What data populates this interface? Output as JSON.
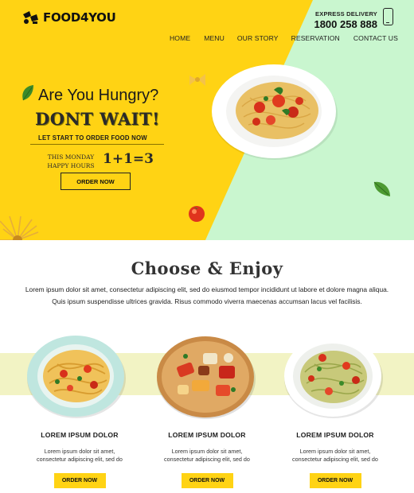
{
  "brand": {
    "name": "FOOD4YOU"
  },
  "contact": {
    "label": "EXPRESS DELIVERY",
    "phone": "1800 258 888"
  },
  "nav": [
    {
      "label": "HOME"
    },
    {
      "label": "MENU"
    },
    {
      "label": "OUR STORY"
    },
    {
      "label": "RESERVATION"
    },
    {
      "label": "CONTACT US"
    }
  ],
  "hero": {
    "title": "Are You Hungry?",
    "subtitle": "DONT WAIT!",
    "tagline": "LET START TO ORDER FOOD NOW",
    "happy_hours_label": "THIS MONDAY HAPPY HOURS",
    "happy_hours_value": "1+1=3",
    "cta": "ORDER NOW"
  },
  "section": {
    "title": "Choose & Enjoy",
    "text": "Lorem ipsum dolor sit amet, consectetur adipiscing elit, sed do eiusmod tempor incididunt ut labore et dolore magna aliqua. Quis ipsum suspendisse ultrices gravida. Risus commodo viverra maecenas accumsan lacus vel facilisis."
  },
  "cards": [
    {
      "title": "LOREM IPSUM DOLOR",
      "text": "Lorem ipsum dolor sit amet, consectetur adipiscing elit, sed do",
      "cta": "ORDER NOW"
    },
    {
      "title": "LOREM IPSUM DOLOR",
      "text": "Lorem ipsum dolor sit amet, consectetur adipiscing elit, sed do",
      "cta": "ORDER NOW"
    },
    {
      "title": "LOREM IPSUM DOLOR",
      "text": "Lorem ipsum dolor sit amet, consectetur adipiscing elit, sed do",
      "cta": "ORDER NOW"
    }
  ],
  "colors": {
    "accent": "#ffd314",
    "mint": "#c9f6cf",
    "band": "#f2f3c4"
  }
}
